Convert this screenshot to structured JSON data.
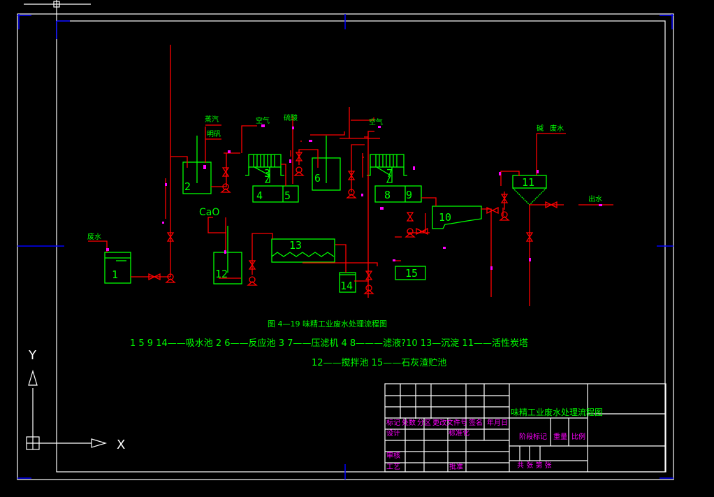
{
  "colors": {
    "background": "#000000",
    "equipment": "#00ff00",
    "pipes": "#ff0000",
    "instruments": "#ff00ff",
    "frame": "#0000ff",
    "border": "#ffffff"
  },
  "units": {
    "u1": "1",
    "u2": "2",
    "u3": "3",
    "u4": "4",
    "u5": "5",
    "u6": "6",
    "u7": "7",
    "u8": "8",
    "u9": "9",
    "u10": "10",
    "u11": "11",
    "u12": "12",
    "u13": "13",
    "u14": "14",
    "u15": "15"
  },
  "streams": {
    "steam": "蒸汽",
    "alum": "明矾",
    "air1": "空气",
    "acid": "硫酸",
    "air2": "空气",
    "wastewater": "废水",
    "cao": "CaO",
    "alkali": "碱",
    "alkali_water": "废水",
    "outlet": "出水"
  },
  "caption": {
    "title": "图 4—19  味精工业废水处理流程图",
    "legend_line1": "1 5 9 14——吸水池  2 6——反应池  3 7——压滤机   4 8———滤液?10  13—沉淀    11——活性炭塔",
    "legend_line2": "12——搅拌池  15——石灰渣贮池"
  },
  "title_block": {
    "drawing_title": "味精工业废水处理流程图",
    "headers": [
      "标记",
      "处数",
      "分区",
      "更改文件号",
      "签名",
      "年月日"
    ],
    "design": "设计",
    "standardize": "标准化",
    "review": "审核",
    "process": "工艺",
    "approve": "批准",
    "stage_mark": "阶段标记",
    "weight": "重量",
    "scale": "比例",
    "sheets": "共   张  第   张"
  },
  "ucs": {
    "x_axis": "X",
    "y_axis": "Y"
  }
}
